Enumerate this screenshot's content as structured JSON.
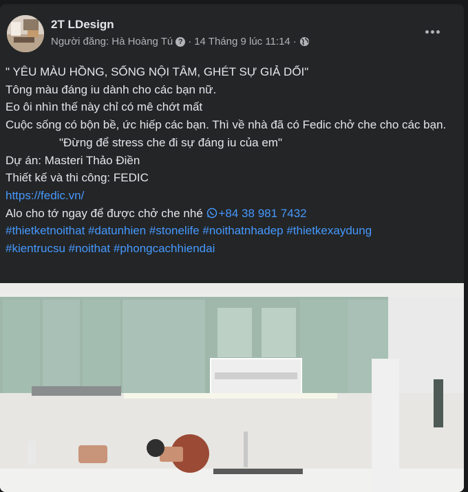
{
  "post": {
    "author": "2T LDesign",
    "meta": {
      "prefix": "Người đăng: Hà Hoàng Tú",
      "separator": "·",
      "timestamp": "14 Tháng 9 lúc 11:14",
      "separator2": "·"
    },
    "lines": [
      "\" YÊU MÀU HỒNG, SỐNG NỘI TÂM, GHÉT SỰ GIẢ DỐI\"",
      "Tông màu đáng iu dành cho các bạn nữ.",
      "Eo ôi nhìn thế này chỉ có mê chớt mất",
      "Cuộc sống có bộn bề, ức hiếp các bạn. Thì về nhà đã có Fedic chở che cho các bạn.",
      "\"Đừng để stress che đi sự đáng iu của em\"",
      "Dự án: Masteri Thảo Điền",
      "Thiết kế và thi công: FEDIC"
    ],
    "website": "https://fedic.vn/",
    "contact_text": "Alo cho tớ ngay để được chở che nhé ",
    "phone": "+84 38 981 7432",
    "hashtags_line1": "#thietketnoithat #datunhien #stonelife #noithatnhadep #thietkexaydung",
    "hashtags_line2": "#kientrucsu #noithat #phongcachhiendai"
  },
  "icons": {
    "more": "more-horizontal-icon",
    "privacy": "globe-icon",
    "question": "question-icon",
    "whatsapp": "whatsapp-icon"
  },
  "colors": {
    "background": "#18191a",
    "card": "#242526",
    "text": "#e4e6eb",
    "secondary": "#b0b3b8",
    "link": "#4599ff"
  }
}
